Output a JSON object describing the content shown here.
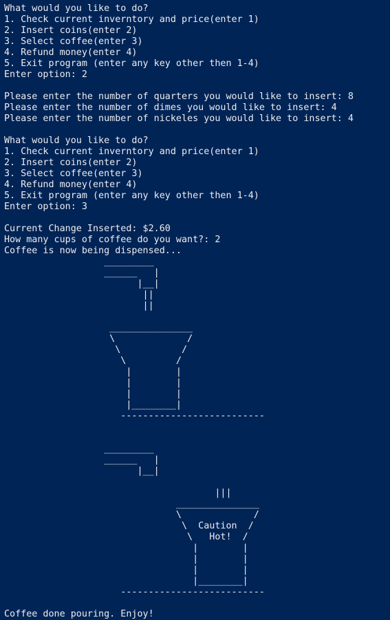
{
  "terminal": {
    "lines": [
      "What would you like to do?",
      "1. Check current inverntory and price(enter 1)",
      "2. Insert coins(enter 2)",
      "3. Select coffee(enter 3)",
      "4. Refund money(enter 4)",
      "5. Exit program (enter any key other then 1-4)",
      "Enter option: 2",
      "",
      "Please enter the number of quarters you would like to insert: 8",
      "Please enter the number of dimes you would like to insert: 4",
      "Please enter the number of nickeles you would like to insert: 4",
      "",
      "What would you like to do?",
      "1. Check current inverntory and price(enter 1)",
      "2. Insert coins(enter 2)",
      "3. Select coffee(enter 3)",
      "4. Refund money(enter 4)",
      "5. Exit program (enter any key other then 1-4)",
      "Enter option: 3",
      "",
      "Current Change Inserted: $2.60",
      "How many cups of coffee do you want?: 2",
      "Coffee is now being dispensed...",
      "                  _________",
      "                  ______   |",
      "                        |__|",
      "                         ||",
      "                         ||",
      "",
      "                   _______________",
      "                   \\             /",
      "                    \\           /",
      "                     \\         /",
      "                      |        |",
      "                      |        |",
      "                      |        |",
      "                      |________|",
      "                     --------------------------",
      "",
      "",
      "                  _________",
      "                  ______   |",
      "                        |__|",
      "",
      "                                      |||",
      "                               _______________",
      "                               \\             /",
      "                                \\  Caution  /",
      "                                 \\   Hot!  /",
      "                                  |        |",
      "                                  |        |",
      "                                  |        |",
      "                                  |________|",
      "                     --------------------------",
      "",
      "Coffee done pouring. Enjoy!"
    ]
  }
}
